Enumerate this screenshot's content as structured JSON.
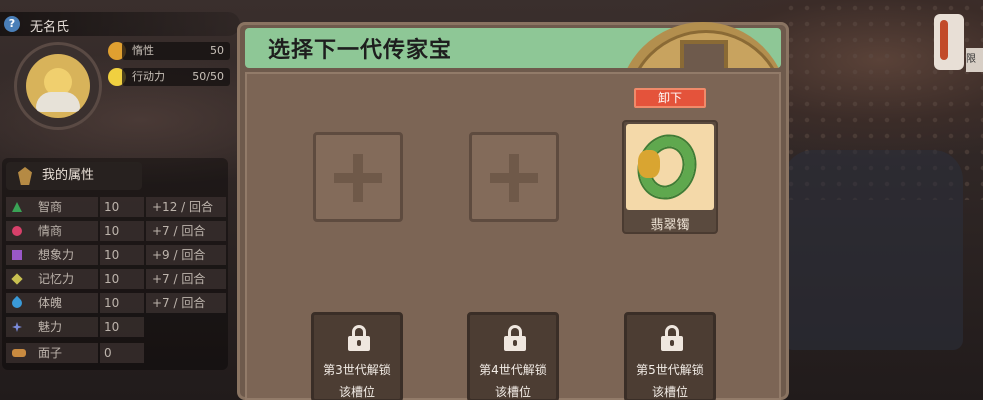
{
  "player": {
    "name": "无名氏",
    "help_label": "?"
  },
  "status": [
    {
      "label": "惰性",
      "value": "50",
      "icon": "inertia-icon",
      "color": "#e0a030"
    },
    {
      "label": "行动力",
      "value": "50/50",
      "icon": "energy-icon",
      "color": "#f0d040"
    }
  ],
  "attributes": {
    "title": "我的属性",
    "rows": [
      {
        "name": "智商",
        "value": "10",
        "rate": "+12 / 回合",
        "icon": "iq-triangle-icon",
        "color": "#3aa356"
      },
      {
        "name": "情商",
        "value": "10",
        "rate": "+7 / 回合",
        "icon": "eq-circle-icon",
        "color": "#d8406a"
      },
      {
        "name": "想象力",
        "value": "10",
        "rate": "+9 / 回合",
        "icon": "imagination-square-icon",
        "color": "#9a58c8"
      },
      {
        "name": "记忆力",
        "value": "10",
        "rate": "+7 / 回合",
        "icon": "memory-diamond-icon",
        "color": "#c8c050"
      },
      {
        "name": "体魄",
        "value": "10",
        "rate": "+7 / 回合",
        "icon": "physique-drop-icon",
        "color": "#3a9ad8"
      },
      {
        "name": "魅力",
        "value": "10",
        "rate": "",
        "icon": "charm-star-icon",
        "color": "#7a8ad8"
      },
      {
        "name": "面子",
        "value": "0",
        "rate": "",
        "icon": "face-icon",
        "color": "#c88a40"
      }
    ]
  },
  "modal": {
    "title": "选择下一代传家宝",
    "unequip_label": "卸下",
    "equipped_item": {
      "name": "翡翠镯",
      "icon": "jade-bangle-icon"
    },
    "locked_slots": [
      {
        "line1": "第3世代解锁",
        "line2": "该槽位"
      },
      {
        "line1": "第4世代解锁",
        "line2": "该槽位"
      },
      {
        "line1": "第5世代解锁",
        "line2": "该槽位"
      }
    ]
  },
  "right_edge": {
    "label": "限"
  }
}
